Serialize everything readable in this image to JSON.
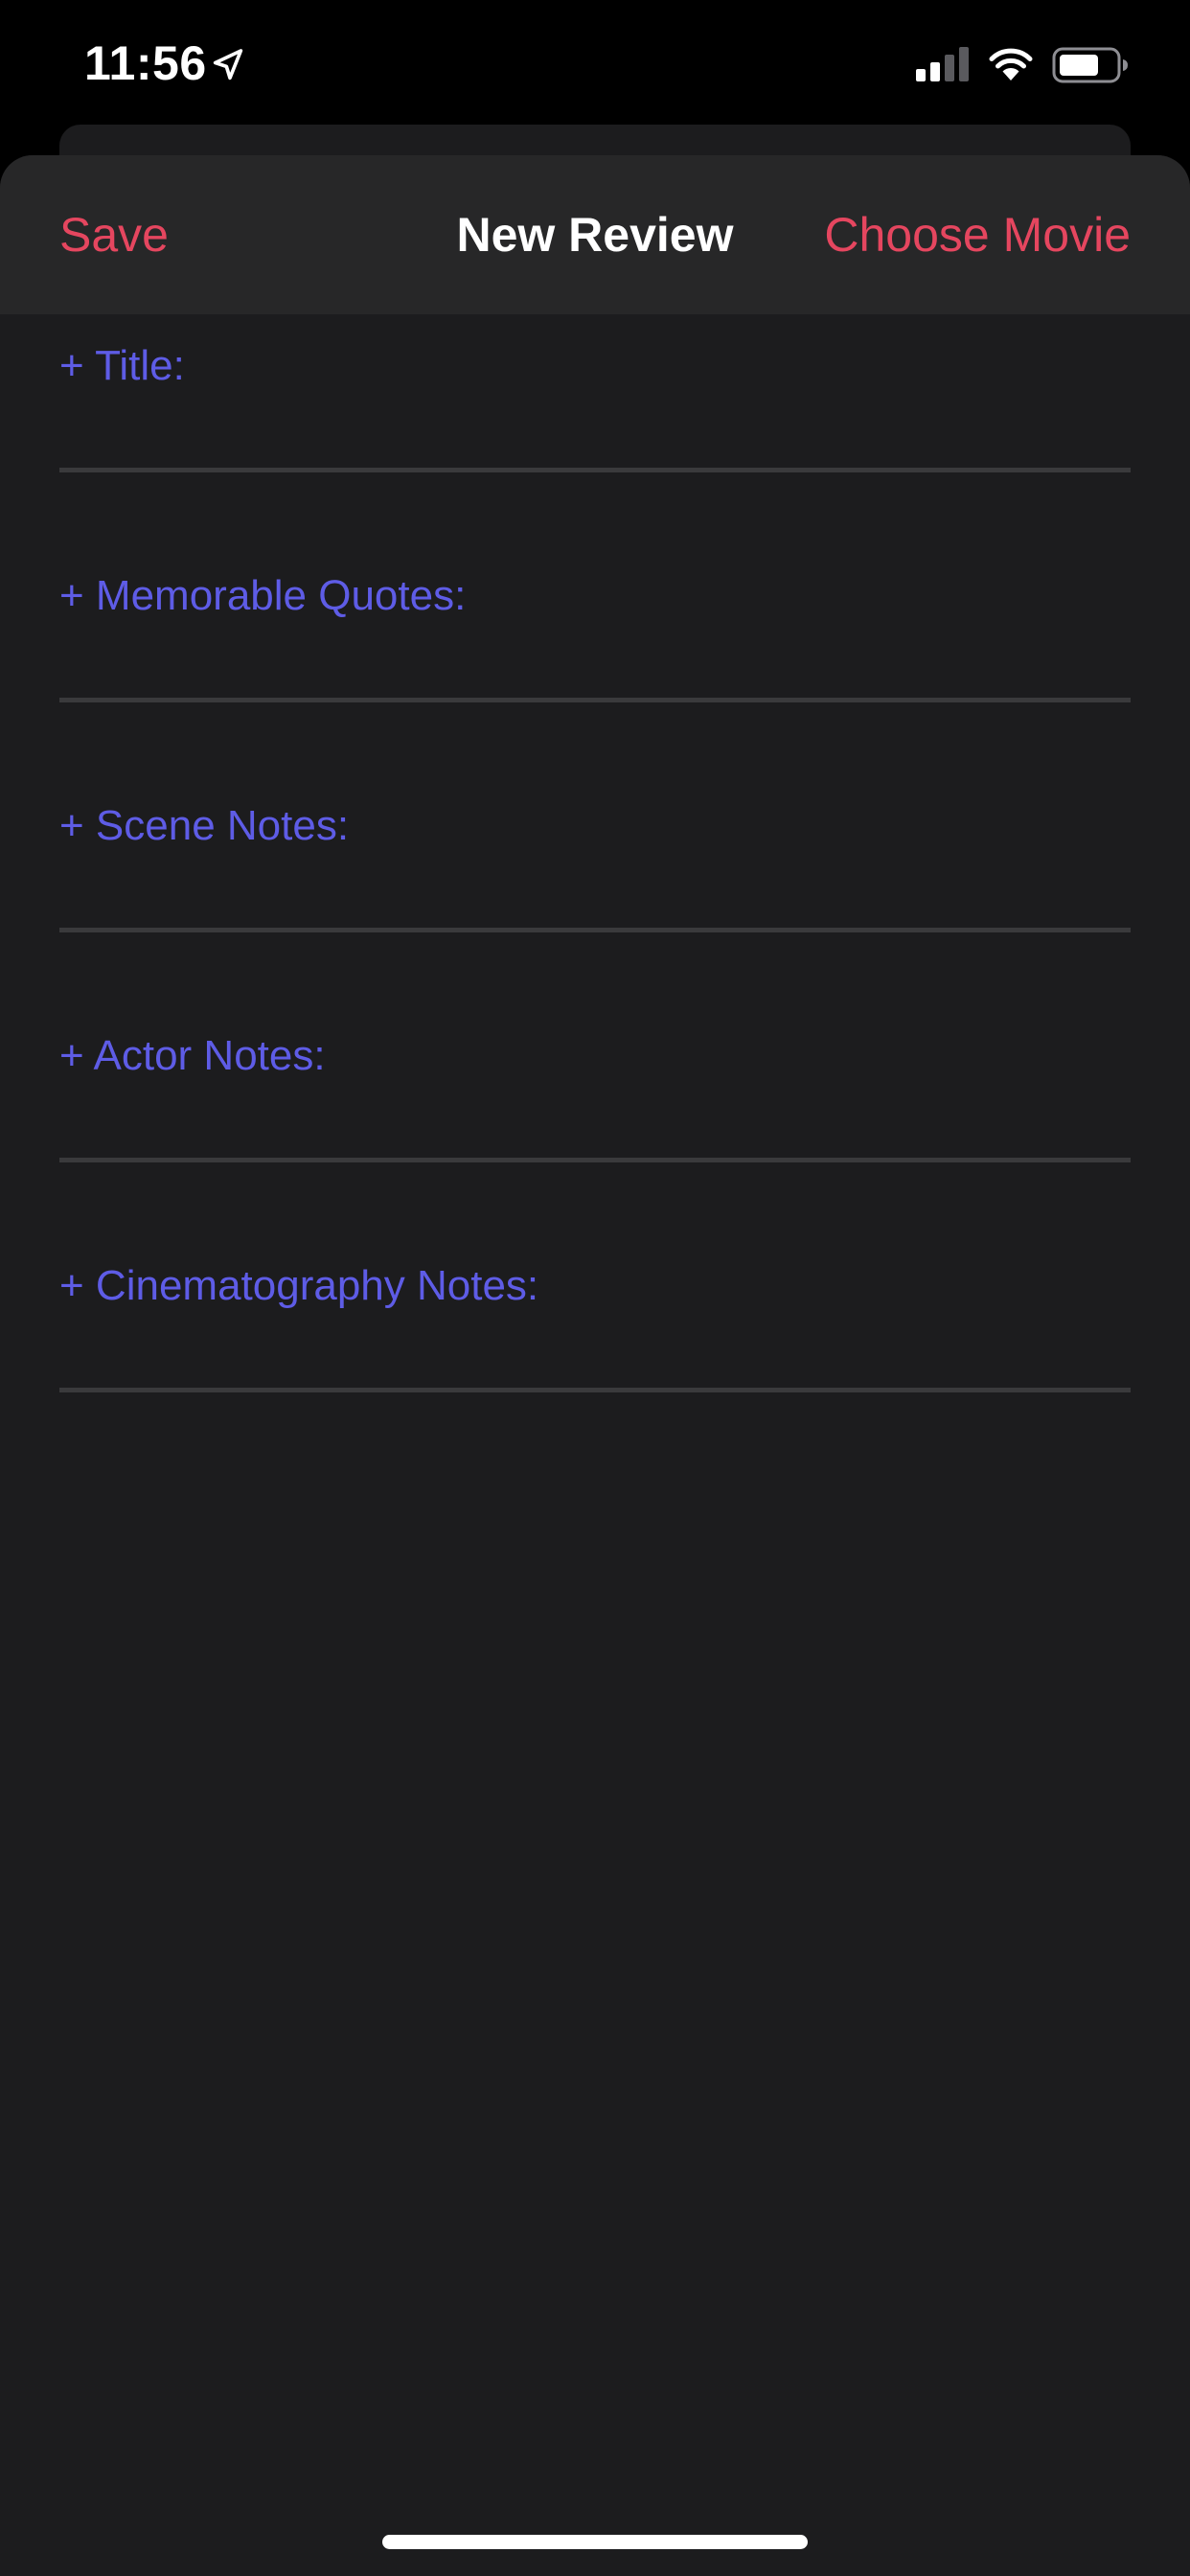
{
  "status_bar": {
    "time": "11:56",
    "icons": [
      "location-arrow-icon",
      "cellular-signal-icon",
      "wifi-icon",
      "battery-icon"
    ]
  },
  "nav": {
    "save_label": "Save",
    "title": "New Review",
    "choose_movie_label": "Choose Movie"
  },
  "form": {
    "fields": [
      {
        "label": "+ Title:",
        "value": ""
      },
      {
        "label": "+ Memorable Quotes:",
        "value": ""
      },
      {
        "label": "+ Scene Notes:",
        "value": ""
      },
      {
        "label": "+ Actor Notes:",
        "value": ""
      },
      {
        "label": "+ Cinematography Notes:",
        "value": ""
      }
    ]
  },
  "colors": {
    "accent_red": "#e5465f",
    "label_purple": "#5e5ce6",
    "sheet_background": "#1c1c1e",
    "nav_background": "#272728"
  }
}
